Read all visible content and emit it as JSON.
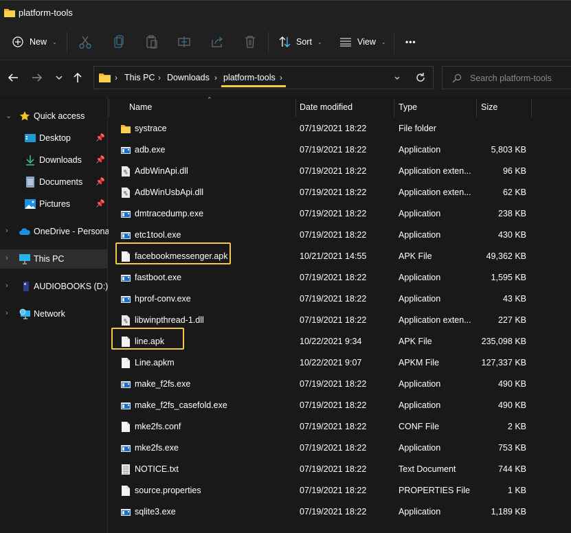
{
  "window": {
    "title": "platform-tools"
  },
  "toolbar": {
    "new_label": "New",
    "sort_label": "Sort",
    "view_label": "View",
    "icons": [
      "cut-icon",
      "copy-icon",
      "paste-icon",
      "rename-icon",
      "share-icon",
      "delete-icon"
    ],
    "more_label": "•••"
  },
  "address": {
    "breadcrumbs": [
      "This PC",
      "Downloads",
      "platform-tools"
    ],
    "separator": "›"
  },
  "search": {
    "placeholder": "Search platform-tools"
  },
  "sidebar": {
    "quick_access": "Quick access",
    "pinned": [
      {
        "label": "Desktop",
        "icon": "desktop-icon"
      },
      {
        "label": "Downloads",
        "icon": "download-icon"
      },
      {
        "label": "Documents",
        "icon": "documents-icon"
      },
      {
        "label": "Pictures",
        "icon": "pictures-icon"
      }
    ],
    "locations": [
      {
        "label": "OneDrive - Personal",
        "icon": "onedrive-icon"
      },
      {
        "label": "This PC",
        "icon": "this-pc-icon",
        "selected": true
      },
      {
        "label": "AUDIOBOOKS (D:)",
        "icon": "drive-icon"
      },
      {
        "label": "Network",
        "icon": "network-icon"
      }
    ]
  },
  "columns": {
    "name": "Name",
    "date": "Date modified",
    "type": "Type",
    "size": "Size",
    "sort_indicator": "^"
  },
  "highlight_color": "#f7c948",
  "files": [
    {
      "name": "systrace",
      "date": "07/19/2021 18:22",
      "type": "File folder",
      "size": "",
      "icon": "folder"
    },
    {
      "name": "adb.exe",
      "date": "07/19/2021 18:22",
      "type": "Application",
      "size": "5,803 KB",
      "icon": "exe"
    },
    {
      "name": "AdbWinApi.dll",
      "date": "07/19/2021 18:22",
      "type": "Application exten...",
      "size": "96 KB",
      "icon": "dll"
    },
    {
      "name": "AdbWinUsbApi.dll",
      "date": "07/19/2021 18:22",
      "type": "Application exten...",
      "size": "62 KB",
      "icon": "dll"
    },
    {
      "name": "dmtracedump.exe",
      "date": "07/19/2021 18:22",
      "type": "Application",
      "size": "238 KB",
      "icon": "exe"
    },
    {
      "name": "etc1tool.exe",
      "date": "07/19/2021 18:22",
      "type": "Application",
      "size": "430 KB",
      "icon": "exe"
    },
    {
      "name": "facebookmessenger.apk",
      "date": "10/21/2021 14:55",
      "type": "APK File",
      "size": "49,362 KB",
      "icon": "file",
      "highlighted": true
    },
    {
      "name": "fastboot.exe",
      "date": "07/19/2021 18:22",
      "type": "Application",
      "size": "1,595 KB",
      "icon": "exe"
    },
    {
      "name": "hprof-conv.exe",
      "date": "07/19/2021 18:22",
      "type": "Application",
      "size": "43 KB",
      "icon": "exe"
    },
    {
      "name": "libwinpthread-1.dll",
      "date": "07/19/2021 18:22",
      "type": "Application exten...",
      "size": "227 KB",
      "icon": "dll"
    },
    {
      "name": "line.apk",
      "date": "10/22/2021 9:34",
      "type": "APK File",
      "size": "235,098 KB",
      "icon": "file",
      "highlighted": true
    },
    {
      "name": "Line.apkm",
      "date": "10/22/2021 9:07",
      "type": "APKM File",
      "size": "127,337 KB",
      "icon": "file"
    },
    {
      "name": "make_f2fs.exe",
      "date": "07/19/2021 18:22",
      "type": "Application",
      "size": "490 KB",
      "icon": "exe"
    },
    {
      "name": "make_f2fs_casefold.exe",
      "date": "07/19/2021 18:22",
      "type": "Application",
      "size": "490 KB",
      "icon": "exe"
    },
    {
      "name": "mke2fs.conf",
      "date": "07/19/2021 18:22",
      "type": "CONF File",
      "size": "2 KB",
      "icon": "file"
    },
    {
      "name": "mke2fs.exe",
      "date": "07/19/2021 18:22",
      "type": "Application",
      "size": "753 KB",
      "icon": "exe"
    },
    {
      "name": "NOTICE.txt",
      "date": "07/19/2021 18:22",
      "type": "Text Document",
      "size": "744 KB",
      "icon": "txt"
    },
    {
      "name": "source.properties",
      "date": "07/19/2021 18:22",
      "type": "PROPERTIES File",
      "size": "1 KB",
      "icon": "file"
    },
    {
      "name": "sqlite3.exe",
      "date": "07/19/2021 18:22",
      "type": "Application",
      "size": "1,189 KB",
      "icon": "exe"
    }
  ]
}
